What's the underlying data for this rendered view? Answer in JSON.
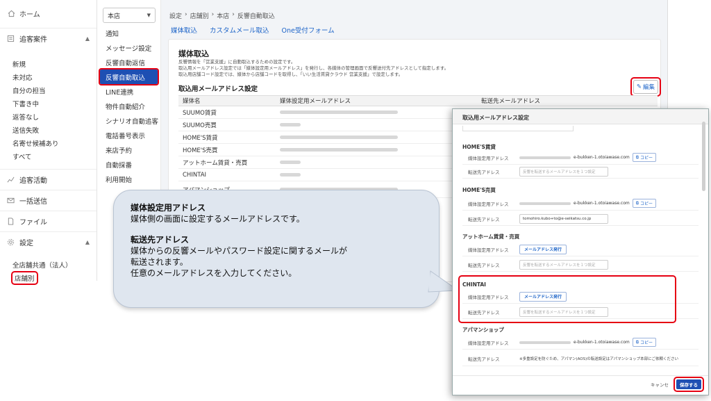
{
  "nav": {
    "home": "ホーム",
    "customers_section": "追客案件",
    "customers_items": [
      "新規",
      "未対応",
      "自分の担当",
      "下書き中",
      "返答なし",
      "送信失敗",
      "名寄せ候補あり",
      "すべて"
    ],
    "activity": "追客活動",
    "bulk_send": "一括送信",
    "files": "ファイル",
    "settings_section": "設定",
    "settings_items": [
      "全店舗共通（法人）",
      "店舗別"
    ]
  },
  "submenu": {
    "store_select": "本店",
    "items": [
      "通知",
      "メッセージ設定",
      "反響自動返信",
      "反響自動取込",
      "LINE連携",
      "物件自動紹介",
      "シナリオ自動追客",
      "電話番号表示",
      "来店予約",
      "自動採番",
      "利用開始"
    ]
  },
  "main": {
    "breadcrumb": [
      "設定",
      "店舗別",
      "本店",
      "反響自動取込"
    ],
    "tabs": [
      "媒体取込",
      "カスタムメール取込",
      "One受付フォーム"
    ],
    "card_title": "媒体取込",
    "desc_lines": [
      "反響情報を「営業支援」に自動取込するための設定です。",
      "取込用メールアドレス設定では「媒体設定用メールアドレス」を発行し、各媒体の管理画面で反響送付先アドレスとして指定します。",
      "取込用店舗コード設定では、媒体から店舗コードを取得し、「いい生活賃貸クラウド 営業支援」で設定します。"
    ],
    "section_title": "取込用メールアドレス設定",
    "edit_label": "編集",
    "table_headers": [
      "媒体名",
      "媒体設定用メールアドレス",
      "転送先メールアドレス"
    ],
    "table_rows": [
      {
        "name": "SUUMO賃貸",
        "copy": true
      },
      {
        "name": "SUUMO売買",
        "copy": false
      },
      {
        "name": "HOME'S賃貸",
        "copy": true
      },
      {
        "name": "HOME'S売買",
        "copy": true
      },
      {
        "name": "アットホーム賃貸・売買",
        "copy": false
      },
      {
        "name": "CHINTAI",
        "copy": false
      },
      {
        "name": "アパマンショップ",
        "copy": true
      }
    ],
    "copy_short": "コ"
  },
  "bubble": {
    "head1": "媒体設定用アドレス",
    "line1": "媒体側の画面に設定するメールアドレスです。",
    "head2": "転送先アドレス",
    "line2a": "媒体からの反響メールやパスワード設定に関するメールが",
    "line2b": "転送されます。",
    "line2c": "任意のメールアドレスを入力してください。"
  },
  "modal": {
    "header": "取込用メールアドレス設定",
    "label_media": "媒体設定用アドレス",
    "label_forward": "転送先アドレス",
    "placeholder": "反響を転送するメールアドレスを１つ設定",
    "copy_label": "コピー",
    "issue_label": "メールアドレス発行",
    "homes_chintai": "HOME'S賃貸",
    "homes_chintai_addr": "e-bukken-1.otoiawase.com",
    "homes_baibai": "HOME'S売買",
    "homes_baibai_addr": "e-bukken-1.otoiawase.com",
    "homes_baibai_forward": "tomohiro.kubo+to@e-seikatsu.co.jp",
    "athome": "アットホーム賃貸・売買",
    "chintai": "CHINTAI",
    "apaman": "アパマンショップ",
    "apaman_addr": "e-bukken-1.otoiawase.com",
    "apaman_note": "※多重設定を防ぐため、アパマン(AOS)の転送設定はアパマンショップ本部にご依頼ください",
    "cancel": "キャンセ",
    "save": "保存する"
  }
}
